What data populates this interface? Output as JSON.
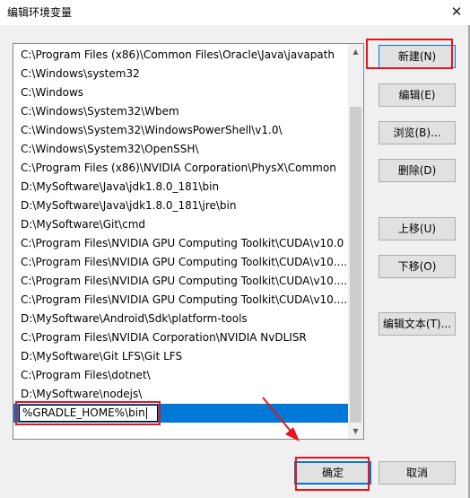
{
  "window": {
    "title": "编辑环境变量",
    "close_glyph": "✕"
  },
  "path_list": {
    "items": [
      "C:\\Program Files (x86)\\Common Files\\Oracle\\Java\\javapath",
      "C:\\Windows\\system32",
      "C:\\Windows",
      "C:\\Windows\\System32\\Wbem",
      "C:\\Windows\\System32\\WindowsPowerShell\\v1.0\\",
      "C:\\Windows\\System32\\OpenSSH\\",
      "C:\\Program Files (x86)\\NVIDIA Corporation\\PhysX\\Common",
      "D:\\MySoftware\\Java\\jdk1.8.0_181\\bin",
      "D:\\MySoftware\\Java\\jdk1.8.0_181\\jre\\bin",
      "D:\\MySoftware\\Git\\cmd",
      "C:\\Program Files\\NVIDIA GPU Computing Toolkit\\CUDA\\v10.0",
      "C:\\Program Files\\NVIDIA GPU Computing Toolkit\\CUDA\\v10....",
      "C:\\Program Files\\NVIDIA GPU Computing Toolkit\\CUDA\\v10....",
      "C:\\Program Files\\NVIDIA GPU Computing Toolkit\\CUDA\\v10....",
      "D:\\MySoftware\\Android\\Sdk\\platform-tools",
      "C:\\Program Files\\NVIDIA Corporation\\NVIDIA NvDLISR",
      "D:\\MySoftware\\Git LFS\\Git LFS",
      "C:\\Program Files\\dotnet\\",
      "D:\\MySoftware\\nodejs\\"
    ],
    "editing_value": "%GRADLE_HOME%\\bin"
  },
  "buttons": {
    "new": "新建(N)",
    "edit": "编辑(E)",
    "browse": "浏览(B)...",
    "delete": "删除(D)",
    "move_up": "上移(U)",
    "move_down": "下移(O)",
    "edit_text": "编辑文本(T)...",
    "ok": "确定",
    "cancel": "取消"
  },
  "colors": {
    "selection": "#0078d7",
    "annotation": "#e8141b"
  }
}
